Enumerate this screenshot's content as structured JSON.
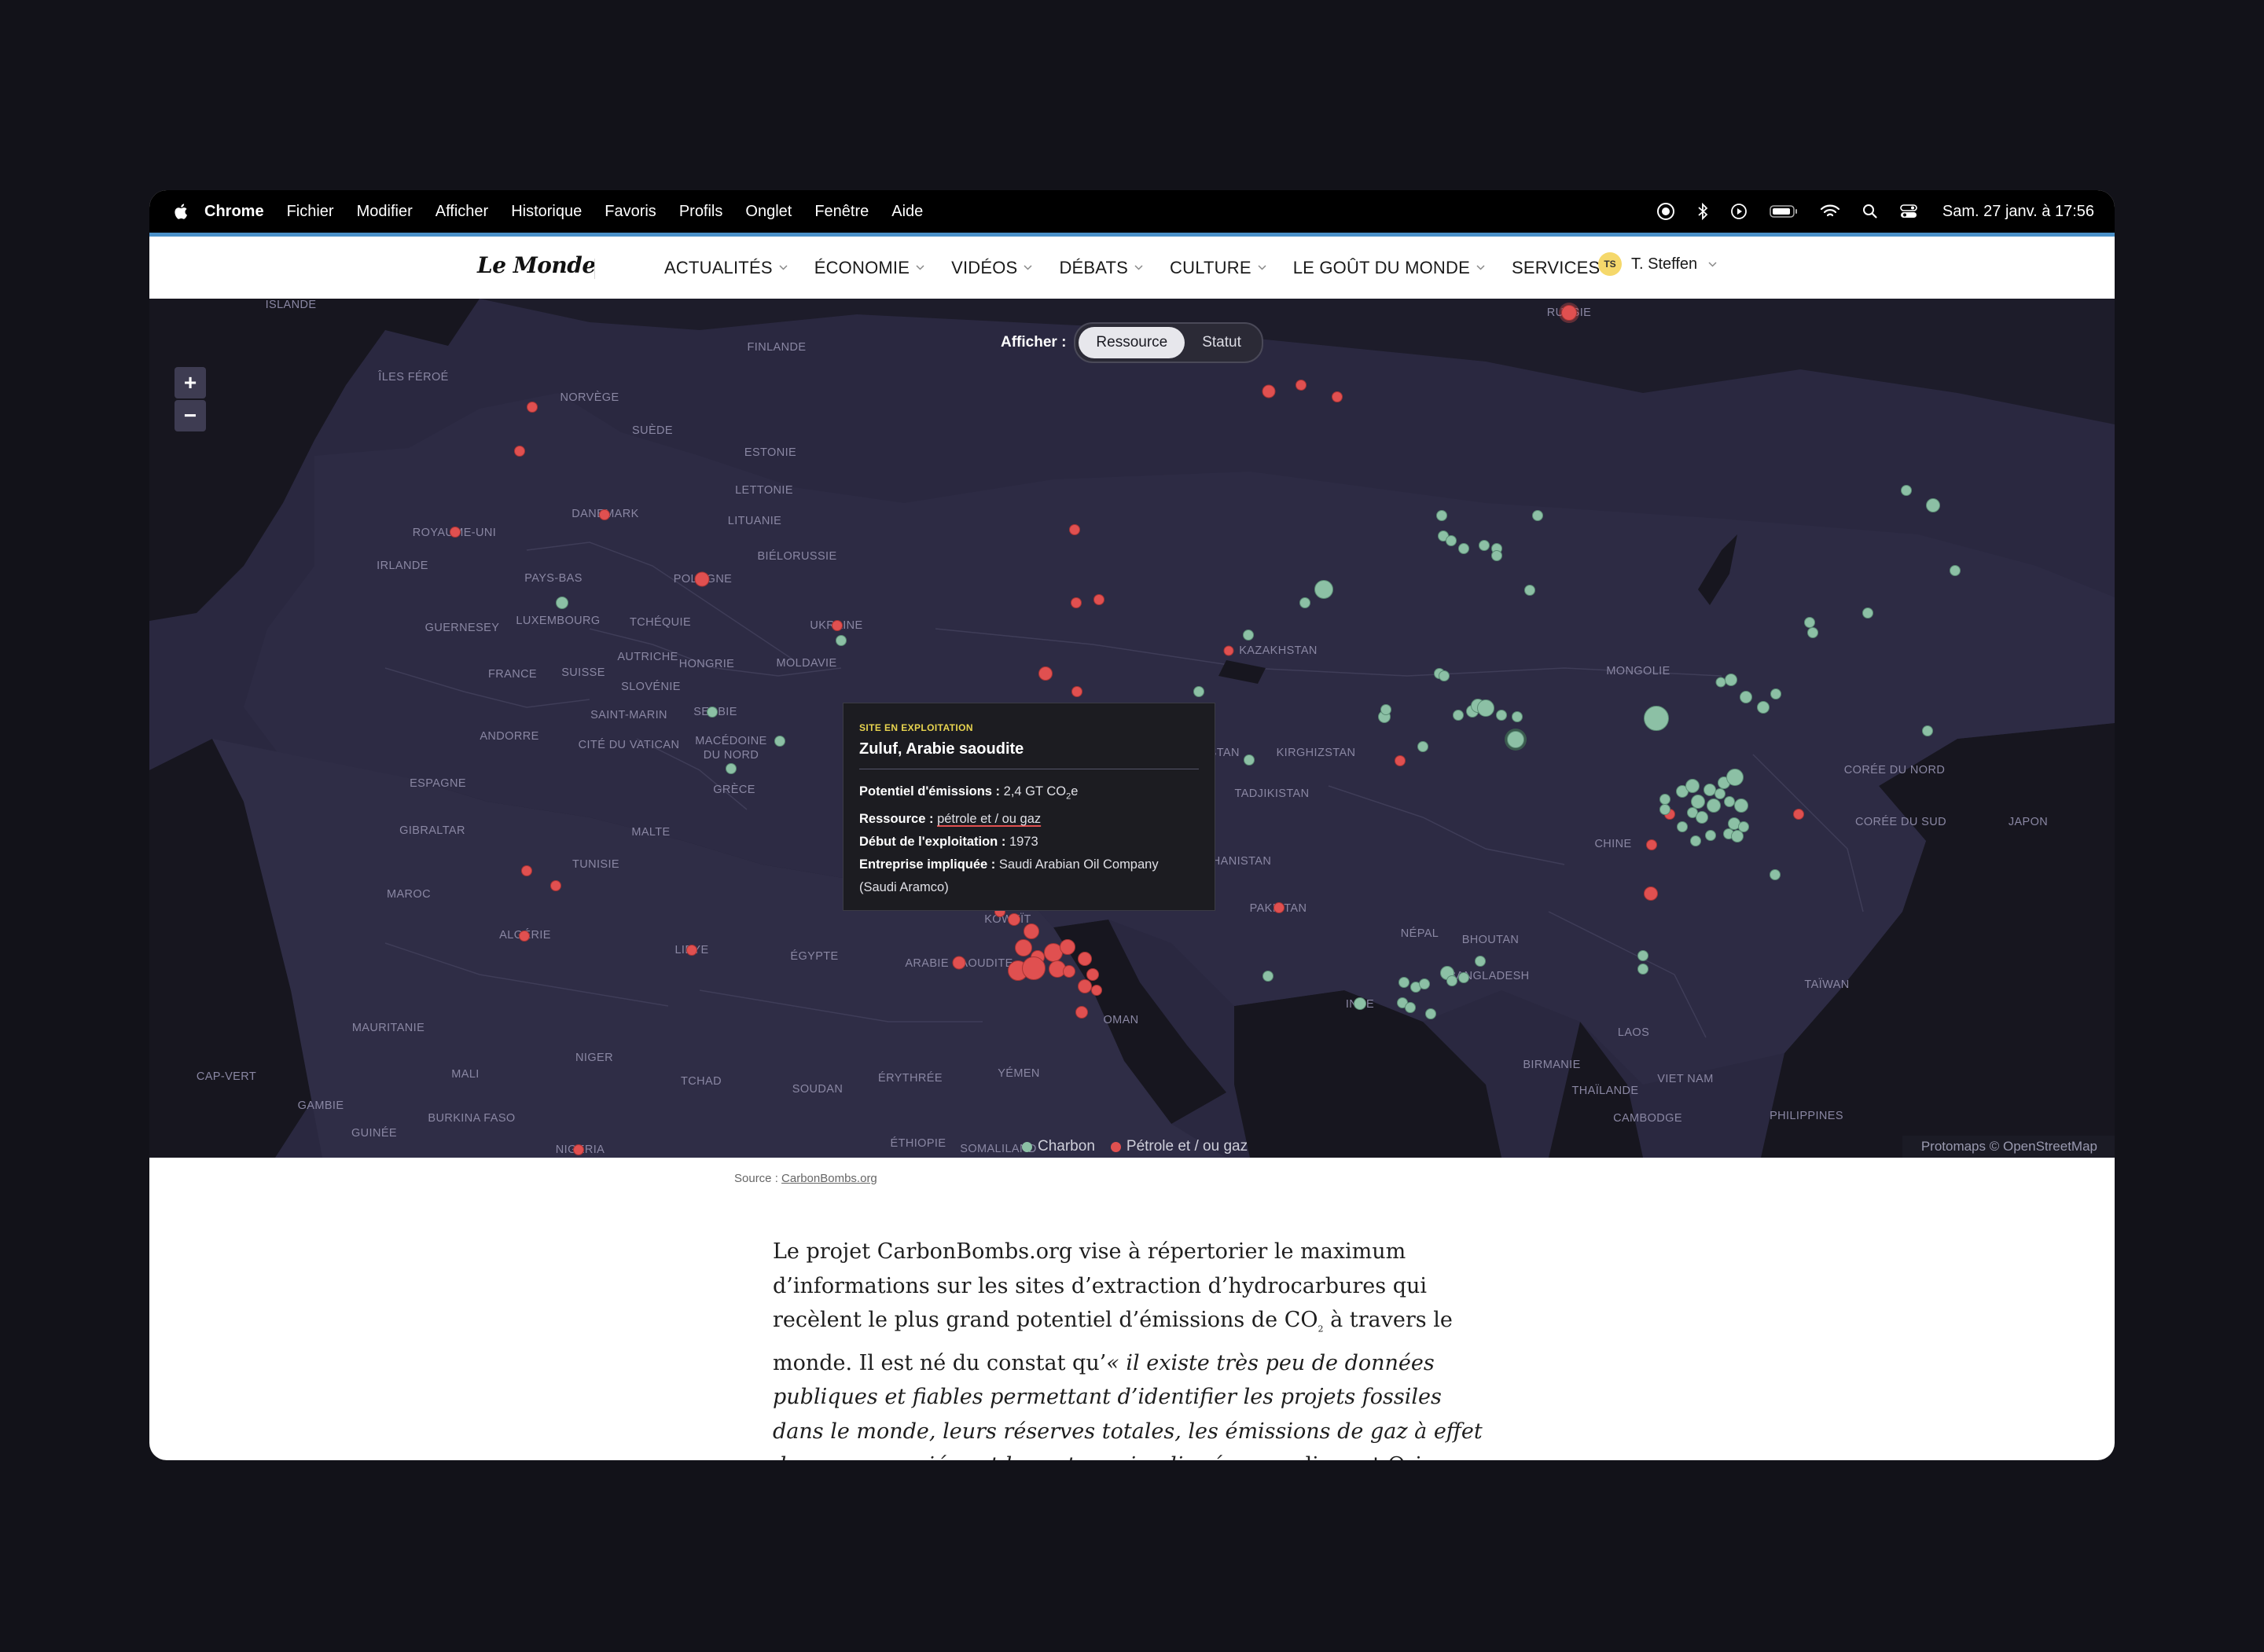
{
  "menubar": {
    "app": "Chrome",
    "items": [
      "Fichier",
      "Modifier",
      "Afficher",
      "Historique",
      "Favoris",
      "Profils",
      "Onglet",
      "Fenêtre",
      "Aide"
    ],
    "clock": "Sam. 27 janv. à  17:56",
    "icons": [
      "apple-icon",
      "screen-share-icon",
      "bluetooth-icon",
      "play-icon",
      "battery-icon",
      "wifi-icon",
      "search-icon",
      "control-center-icon"
    ]
  },
  "site": {
    "logo": "Le Monde",
    "nav": [
      "ACTUALITÉS",
      "ÉCONOMIE",
      "VIDÉOS",
      "DÉBATS",
      "CULTURE",
      "LE GOÛT DU MONDE",
      "SERVICES"
    ],
    "user_initials": "TS",
    "user_name": "T. Steffen"
  },
  "map": {
    "toggle_label": "Afficher :",
    "toggle_options": [
      "Ressource",
      "Statut"
    ],
    "toggle_selected": "Ressource",
    "zoom_in": "+",
    "zoom_out": "−",
    "legend": [
      {
        "label": "Charbon",
        "color": "#8cc0a5"
      },
      {
        "label": "Pétrole et / ou gaz",
        "color": "#e05050"
      }
    ],
    "attribution": "Protomaps © OpenStreetMap",
    "labels": [
      "ISLANDE",
      "ÎLES FÉROÉ",
      "NORVÈGE",
      "SUÈDE",
      "FINLANDE",
      "ESTONIE",
      "LETTONIE",
      "LITUANIE",
      "DANEMARK",
      "ROYAUME-UNI",
      "IRLANDE",
      "PAYS-BAS",
      "BIÉLORUSSIE",
      "POLOGNE",
      "GUERNESEY",
      "LUXEMBOURG",
      "TCHÉQUIE",
      "UKRAINE",
      "FRANCE",
      "SUISSE",
      "AUTRICHE",
      "HONGRIE",
      "MOLDAVIE",
      "SLOVÉNIE",
      "SAINT-MARIN",
      "SERBIE",
      "ANDORRE",
      "CITÉ DU VATICAN",
      "MACÉDOINE DU NORD",
      "ESPAGNE",
      "GRÈCE",
      "GIBRALTAR",
      "MALTE",
      "TUNISIE",
      "MAROC",
      "ALGÉRIE",
      "LIBYE",
      "ÉGYPTE",
      "MAURITANIE",
      "MALI",
      "NIGER",
      "TCHAD",
      "SOUDAN",
      "ÉRYTHRÉE",
      "YÉMEN",
      "CAP-VERT",
      "GAMBIE",
      "GUINÉE",
      "BURKINA FASO",
      "NIGERIA",
      "ÉTHIOPIE",
      "SOMALILAND",
      "ARABIE SAOUDITE",
      "KOWEÏT",
      "OMAN",
      "KAZAKHSTAN",
      "KIRGHIZSTAN",
      "TADJIKISTAN",
      "AFGHANISTAN",
      "OUZBÉKISTAN",
      "PAKISTAN",
      "NÉPAL",
      "BHOUTAN",
      "BANGLADESH",
      "INDE",
      "MONGOLIE",
      "CHINE",
      "CORÉE DU NORD",
      "CORÉE DU SUD",
      "JAPON",
      "TAÏWAN",
      "LAOS",
      "BIRMANIE",
      "THAÏLANDE",
      "VIET NAM",
      "CAMBODGE",
      "PHILIPPINES",
      "RUSSIE"
    ]
  },
  "tooltip": {
    "kicker": "SITE EN EXPLOITATION",
    "title": "Zuluf, Arabie saoudite",
    "rows": [
      {
        "label": "Potentiel d'émissions :",
        "value": "2,4 GT CO",
        "sub": "2",
        "suffix": "e"
      },
      {
        "label": "Ressource :",
        "value": "pétrole et / ou gaz"
      },
      {
        "label": "Début de l'exploitation :",
        "value": "1973"
      },
      {
        "label": "Entreprise impliquée :",
        "value": "Saudi Arabian Oil Company (Saudi Aramco)"
      }
    ]
  },
  "source": {
    "prefix": "Source :",
    "link": "CarbonBombs.org"
  },
  "article": {
    "p1_a": "Le projet CarbonBombs.org vise à répertorier le maximum d’informations sur les sites d’extraction d’hydrocarbures qui recèlent le plus grand potentiel d’émissions de CO",
    "p1_sub": "2",
    "p1_b": " à travers le monde. Il est né du constat qu’",
    "p1_quote": "« il existe très peu de données publiques et fiables permettant d’identifier les projets fossiles dans le monde, leurs réserves totales, les émissions de gaz à effet de serre associées et les acteurs impliqués »",
    "p1_c": ", expliquent Oriane Wegner et Lou Welgryn. Les cofondatrices d’Eclaircies"
  }
}
